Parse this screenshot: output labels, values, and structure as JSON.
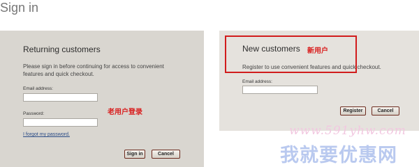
{
  "page": {
    "title": "Sign in"
  },
  "returning": {
    "heading": "Returning customers",
    "description_line1": "Please sign in before continuing for access to convenient",
    "description_line2": "features and quick checkout.",
    "email_label": "Email address:",
    "password_label": "Password:",
    "forgot_link": "I forgot my password.",
    "signin_button": "Sign in",
    "cancel_button": "Cancel",
    "annotation": "老用户登录"
  },
  "new_customers": {
    "heading": "New customers",
    "annotation": "新用户",
    "description": "Register to use convenient features and quick checkout.",
    "email_label": "Email address:",
    "register_button": "Register",
    "cancel_button": "Cancel"
  },
  "watermark": {
    "url": "www.591yhw.com",
    "text": "我就要优惠网"
  },
  "colors": {
    "annotation_red": "#d91b1b",
    "panel_left_bg": "#d9d6d0",
    "panel_right_bg": "#e5e2dd",
    "button_border": "#6d2b1f",
    "link_blue": "#2a4b86"
  }
}
